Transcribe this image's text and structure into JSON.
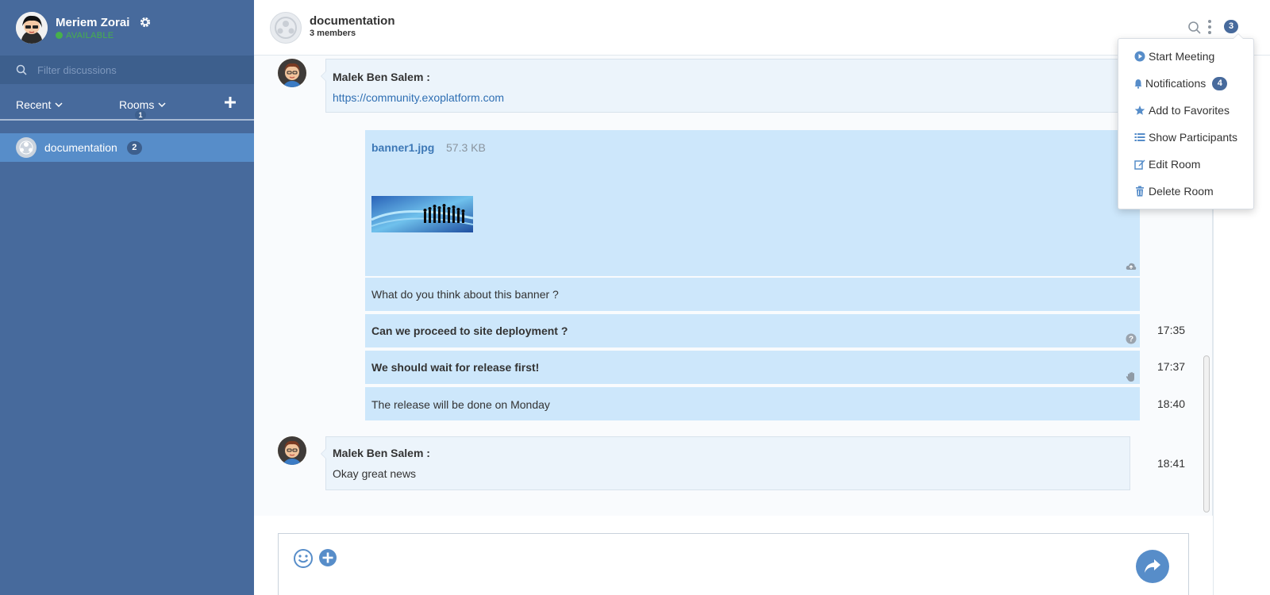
{
  "user": {
    "name": "Meriem Zorai",
    "status": "AVAILABLE"
  },
  "filter": {
    "placeholder": "Filter discussions"
  },
  "tabs": {
    "recent": "Recent",
    "rooms": "Rooms",
    "rooms_count": "1"
  },
  "rooms": [
    {
      "name": "documentation",
      "badge": "2"
    }
  ],
  "header": {
    "title": "documentation",
    "subtitle": "3 members",
    "badge": "3"
  },
  "messages": {
    "first": {
      "author": "Malek Ben Salem :",
      "link": "https://community.exoplatform.com"
    },
    "file": {
      "name": "banner1.jpg",
      "size": "57.3 KB"
    },
    "lines": [
      {
        "text": "What do you think about this banner ?",
        "time": ""
      },
      {
        "text": "Can we proceed to site deployment ?",
        "time": "17:35"
      },
      {
        "text": "We should wait for release first!",
        "time": "17:37"
      },
      {
        "text": "The release will be done on Monday",
        "time": "18:40"
      }
    ],
    "last": {
      "author": "Malek Ben Salem :",
      "text": "Okay great news",
      "time": "18:41"
    }
  },
  "menu": {
    "start_meeting": "Start Meeting",
    "notifications": "Notifications",
    "notifications_badge": "4",
    "add_favorites": "Add to Favorites",
    "show_participants": "Show Participants",
    "edit_room": "Edit Room",
    "delete_room": "Delete Room"
  },
  "colors": {
    "sidebar": "#476a9c",
    "active_room": "#578dc9",
    "message_block": "#cde7fb",
    "accent": "#578dc9"
  }
}
